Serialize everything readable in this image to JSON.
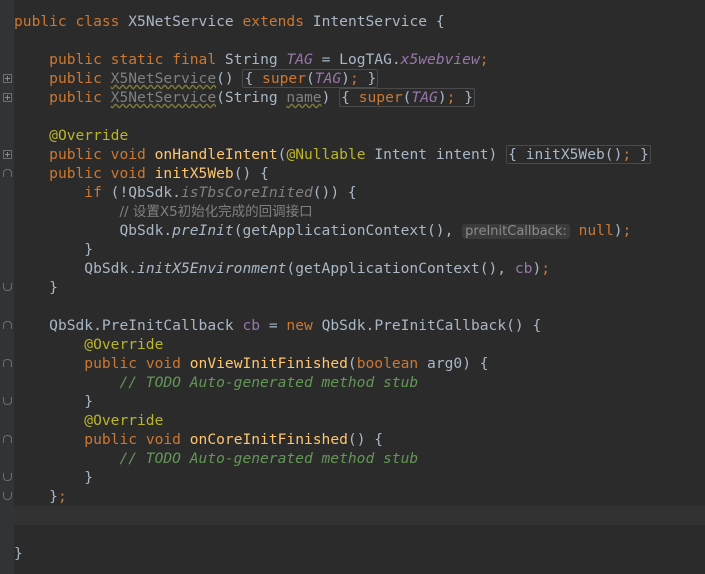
{
  "editor": {
    "lines": [
      {
        "t": "public class X5NetService extends IntentService {"
      },
      {
        "t": ""
      },
      {
        "t": "    public static final String TAG = LogTAG.x5webview;"
      },
      {
        "t": "    public X5NetService() { super(TAG); }"
      },
      {
        "t": "    public X5NetService(String name) { super(TAG); }"
      },
      {
        "t": ""
      },
      {
        "t": "    @Override"
      },
      {
        "t": "    public void onHandleIntent(@Nullable Intent intent) { initX5Web(); }"
      },
      {
        "t": "    public void initX5Web() {"
      },
      {
        "t": "        if (!QbSdk.isTbsCoreInited()) {"
      },
      {
        "t": "            // 设置X5初始化完成的回调接口"
      },
      {
        "t": "            QbSdk.preInit(getApplicationContext(), preInitCallback: null);"
      },
      {
        "t": "        }"
      },
      {
        "t": "        QbSdk.initX5Environment(getApplicationContext(), cb);"
      },
      {
        "t": "    }"
      },
      {
        "t": ""
      },
      {
        "t": "    QbSdk.PreInitCallback cb = new QbSdk.PreInitCallback() {"
      },
      {
        "t": "        @Override"
      },
      {
        "t": "        public void onViewInitFinished(boolean arg0) {"
      },
      {
        "t": "            // TODO Auto-generated method stub"
      },
      {
        "t": "        }"
      },
      {
        "t": "        @Override"
      },
      {
        "t": "        public void onCoreInitFinished() {"
      },
      {
        "t": "            // TODO Auto-generated method stub"
      },
      {
        "t": "        }"
      },
      {
        "t": "    };"
      },
      {
        "t": ""
      },
      {
        "t": ""
      },
      {
        "t": "}"
      }
    ],
    "tokens": {
      "public": "public",
      "class": "class",
      "extends": "extends",
      "static": "static",
      "final": "final",
      "void": "void",
      "if": "if",
      "new": "new",
      "super": "super",
      "boolean": "boolean",
      "X5NetService": "X5NetService",
      "IntentService": "IntentService",
      "String": "String",
      "TAG": "TAG",
      "LogTAG": "LogTAG",
      "x5webview": "x5webview",
      "name": "name",
      "Override": "@Override",
      "onHandleIntent": "onHandleIntent",
      "Nullable": "@Nullable",
      "Intent": "Intent",
      "intent": "intent",
      "initX5Web": "initX5Web",
      "QbSdk": "QbSdk",
      "isTbsCoreInited": "isTbsCoreInited",
      "comment_cn": "// 设置X5初始化完成的回调接口",
      "preInit": "preInit",
      "getApplicationContext": "getApplicationContext",
      "hint_preInitCallback": "preInitCallback:",
      "null": "null",
      "initX5Environment": "initX5Environment",
      "cb": "cb",
      "PreInitCallback": "PreInitCallback",
      "onViewInitFinished": "onViewInitFinished",
      "arg0": "arg0",
      "todo": "// TODO Auto-generated method stub",
      "onCoreInitFinished": "onCoreInitFinished"
    },
    "colors": {
      "background": "#2b2b2b",
      "keyword": "#cc7832",
      "method": "#ffc66d",
      "static_field": "#9876aa",
      "annotation": "#bbb529",
      "comment": "#629755",
      "text": "#a9b7c6"
    }
  }
}
